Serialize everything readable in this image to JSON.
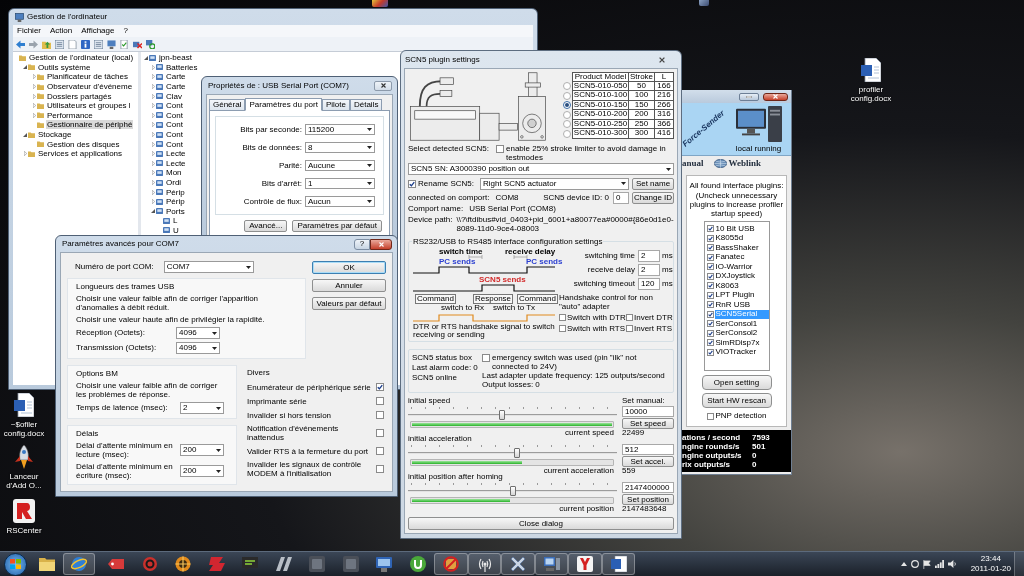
{
  "desktop_icons": [
    {
      "kind": "document",
      "label": "profiler config.docx"
    },
    {
      "kind": "document",
      "label": "~$ofiler config.docx"
    },
    {
      "kind": "rocket",
      "label": "Lanceur d'Add O..."
    },
    {
      "kind": "app",
      "label": "RSCenter"
    }
  ],
  "computer_management": {
    "title": "Gestion de l'ordinateur",
    "menu": [
      "Fichier",
      "Action",
      "Affichage",
      "?"
    ],
    "nav_tree": [
      {
        "label": "Gestion de l'ordinateur (local)",
        "selected": false,
        "children": [
          {
            "label": "Outils système",
            "expanded": true,
            "selected": false,
            "children": [
              {
                "label": "Planificateur de tâches",
                "expanded": false,
                "selected": false
              },
              {
                "label": "Observateur d'événeme",
                "expanded": false,
                "selected": false
              },
              {
                "label": "Dossiers partagés",
                "expanded": false,
                "selected": false
              },
              {
                "label": "Utilisateurs et groupes l",
                "expanded": false,
                "selected": false
              },
              {
                "label": "Performance",
                "expanded": false,
                "selected": false
              },
              {
                "label": "Gestionnaire de périphé",
                "selected": true
              }
            ]
          },
          {
            "label": "Stockage",
            "expanded": true,
            "selected": false,
            "children": [
              {
                "label": "Gestion des disques",
                "selected": false
              }
            ]
          },
          {
            "label": "Services et applications",
            "expanded": false,
            "selected": false
          }
        ]
      }
    ],
    "device_tree": [
      {
        "label": "jpn-beast",
        "expanded": true,
        "children": [
          {
            "label": "Batteries",
            "expanded": false
          },
          {
            "label": "Carte",
            "expanded": false
          },
          {
            "label": "Carte",
            "expanded": false
          },
          {
            "label": "Clav",
            "expanded": false
          },
          {
            "label": "Cont",
            "expanded": false
          },
          {
            "label": "Cont",
            "expanded": false
          },
          {
            "label": "Cont",
            "expanded": false
          },
          {
            "label": "Cont",
            "expanded": false
          },
          {
            "label": "Cont",
            "expanded": false
          },
          {
            "label": "Lecte",
            "expanded": false
          },
          {
            "label": "Lecte",
            "expanded": false
          },
          {
            "label": "Mon",
            "expanded": false
          },
          {
            "label": "Ordi",
            "expanded": false
          },
          {
            "label": "Périp",
            "expanded": false
          },
          {
            "label": "Périp",
            "expanded": false
          },
          {
            "label": "Ports",
            "expanded": true,
            "children": [
              {
                "label": "L"
              },
              {
                "label": "U"
              }
            ]
          }
        ]
      }
    ]
  },
  "properties": {
    "title": "Propriétés de : USB Serial Port (COM7)",
    "tabs": [
      {
        "label": "Général",
        "selected": false
      },
      {
        "label": "Paramètres du port",
        "selected": true
      },
      {
        "label": "Pilote",
        "selected": false
      },
      {
        "label": "Détails",
        "selected": false
      }
    ],
    "fields": [
      {
        "label": "Bits par seconde:",
        "value": "115200"
      },
      {
        "label": "Bits de données:",
        "value": "8"
      },
      {
        "label": "Parité:",
        "value": "Aucune"
      },
      {
        "label": "Bits d'arrêt:",
        "value": "1"
      },
      {
        "label": "Contrôle de flux:",
        "value": "Aucun"
      }
    ],
    "buttons": [
      "Avancé...",
      "Paramètres par défaut"
    ]
  },
  "advanced": {
    "title": "Paramètres avancés pour COM7",
    "help": "?",
    "port": {
      "label": "Numéro de port COM:",
      "value": "COM7"
    },
    "usb": {
      "title": "Longueurs des trames USB",
      "lines": [
        "Choisir une valeur faible afin de corriger l'apparition d'anomalies à débit réduit.",
        "Choisir une valeur haute afin de privilégier la rapidité."
      ],
      "fields": [
        {
          "label": "Réception (Octets):",
          "value": "4096"
        },
        {
          "label": "Transmission (Octets):",
          "value": "4096"
        }
      ]
    },
    "bm": {
      "title": "Options BM",
      "text": "Choisir une valeur faible afin de corriger les problèmes de réponse.",
      "field": {
        "label": "Temps de latence (msec):",
        "value": "2"
      }
    },
    "delays": {
      "title": "Délais",
      "fields": [
        {
          "label": "Délai d'attente minimum en lecture (msec):",
          "value": "200"
        },
        {
          "label": "Délai d'attente minimum en écriture (msec):",
          "value": "200"
        }
      ]
    },
    "misc": {
      "title": "Divers",
      "options": [
        {
          "label": "Enumérateur de périphérique série",
          "checked": true
        },
        {
          "label": "Imprimante série",
          "checked": false
        },
        {
          "label": "Invalider si hors tension",
          "checked": false
        },
        {
          "label": "Notification d'événements inattendus",
          "checked": false
        },
        {
          "label": "Valider RTS à la fermeture du port",
          "checked": false
        },
        {
          "label": "Invalider les signaux de contrôle MODEM à l'initialisation",
          "checked": false
        }
      ]
    },
    "buttons": [
      {
        "label": "OK",
        "default": true
      },
      {
        "label": "Annuler",
        "default": false
      },
      {
        "label": "Valeurs par défaut",
        "default": false
      }
    ]
  },
  "scn5": {
    "title": "SCN5 plugin settings",
    "models": {
      "columns": [
        "Product Model",
        "Stroke",
        "L"
      ],
      "rows": [
        {
          "cells": [
            "SCN5-010-050",
            "50",
            "166"
          ],
          "selected": false
        },
        {
          "cells": [
            "SCN5-010-100",
            "100",
            "216"
          ],
          "selected": false
        },
        {
          "cells": [
            "SCN5-010-150",
            "150",
            "266"
          ],
          "selected": true
        },
        {
          "cells": [
            "SCN5-010-200",
            "200",
            "316"
          ],
          "selected": false
        },
        {
          "cells": [
            "SCN5-010-250",
            "250",
            "366"
          ],
          "selected": false
        },
        {
          "cells": [
            "SCN5-010-300",
            "300",
            "416"
          ],
          "selected": false
        }
      ]
    },
    "select_label": "Select detected SCN5:",
    "stroke_limiter": {
      "label": "enable 25% stroke limiter to avoid damage in testmodes",
      "checked": false
    },
    "detected": "SCN5 SN: A3000390 position out",
    "rename": {
      "label": "Rename SCN5:",
      "checked": true,
      "value": "Right SCN5 actuator",
      "button": "Set name"
    },
    "connection": {
      "label": "connected on comport:",
      "comport": "COM8",
      "device_id_label": "SCN5 device ID: 0",
      "device_id": "0",
      "button": "Change ID"
    },
    "comport_name": {
      "label": "Comport name:",
      "value": "USB Serial Port (COM8)"
    },
    "device_path": {
      "label": "Device path:",
      "value": "\\\\?\\ftdibus#vid_0403+pid_6001+a80077ea#0000#{86e0d1e0-8089-11d0-9ce4-08003"
    },
    "interface": {
      "title": "RS232/USB to RS485 interface configuration settings",
      "diagram": {
        "switch_time": "switch time",
        "receive_delay": "receive delay",
        "senders": [
          {
            "label": "PC sends",
            "color": "#2b3fd0"
          },
          {
            "label": "SCN5 sends",
            "color": "#d22b2b"
          },
          {
            "label": "PC sends",
            "color": "#2b3fd0"
          }
        ],
        "frames": [
          {
            "kind": "box",
            "label": "Command"
          },
          {
            "kind": "note",
            "label": "switch to Rx"
          },
          {
            "kind": "box",
            "label": "Response"
          },
          {
            "kind": "note",
            "label": "switch to Tx"
          },
          {
            "kind": "box",
            "label": "Command"
          }
        ],
        "caption": "DTR or RTS handshake signal to switch receiving or sending"
      },
      "timings": [
        {
          "label": "switching time",
          "value": "2",
          "unit": "ms"
        },
        {
          "label": "receive delay",
          "value": "2",
          "unit": "ms"
        },
        {
          "label": "switching timeout",
          "value": "120",
          "unit": "ms"
        }
      ],
      "handshake_title": "Handshake control for non \"auto\" adapter",
      "handshake": [
        {
          "label": "Switch with DTR",
          "checked": false
        },
        {
          "label": "Invert DTR",
          "checked": false
        },
        {
          "label": "Switch with RTS",
          "checked": false
        },
        {
          "label": "Invert RTS",
          "checked": false
        }
      ]
    },
    "status": {
      "title": "SCN5 status box",
      "alarm": "Last alarm code: 0",
      "online": "SCN5 online",
      "emergency": {
        "label": "emergency switch was used (pin \"ilk\" not connected to 24V)",
        "checked": false
      },
      "frequency": "Last adapter update frequency: 125 outputs/second",
      "losses": "Output losses: 0"
    },
    "set_manual": "Set manual:",
    "controls": [
      {
        "label": "initial speed",
        "slider": {
          "level": 0.45
        },
        "progress": {
          "level": 1
        },
        "current_label": "current speed",
        "input": "10000",
        "button": "Set speed",
        "current": "22499"
      },
      {
        "label": "initial acceleration",
        "slider": {
          "level": 0.52
        },
        "progress": {
          "level": 0.55
        },
        "current_label": "current acceleration",
        "input": "512",
        "button": "Set accel.",
        "current": "559"
      },
      {
        "label": "initial position after homing",
        "slider": {
          "level": 0.5
        },
        "progress": {
          "level": 0.49
        },
        "current_label": "current position",
        "input": "2147400000",
        "button": "Set position",
        "current": "2147483648"
      }
    ],
    "close": "Close dialog"
  },
  "force_sender": {
    "banner_title": "Force-Sender",
    "banner_status": "local running",
    "links": [
      {
        "label": "anual",
        "icon": false
      },
      {
        "label": "Weblink",
        "icon": true
      }
    ],
    "plugins_heading": "All found interface plugins:",
    "plugins_hint": "(Uncheck unnecessary plugins to increase profiler startup speed)",
    "plugins": [
      {
        "label": "10 Bit USB",
        "checked": true,
        "selected": false
      },
      {
        "label": "K8055d",
        "checked": true,
        "selected": false
      },
      {
        "label": "BassShaker",
        "checked": true,
        "selected": false
      },
      {
        "label": "Fanatec",
        "checked": true,
        "selected": false
      },
      {
        "label": "IO-Warrior",
        "checked": true,
        "selected": false
      },
      {
        "label": "DXJoystick",
        "checked": true,
        "selected": false
      },
      {
        "label": "K8063",
        "checked": true,
        "selected": false
      },
      {
        "label": "LPT Plugin",
        "checked": true,
        "selected": false
      },
      {
        "label": "RnR USB",
        "checked": true,
        "selected": false
      },
      {
        "label": "SCN5Serial",
        "checked": true,
        "selected": true
      },
      {
        "label": "SerConsol1",
        "checked": true,
        "selected": false
      },
      {
        "label": "SerConsol2",
        "checked": true,
        "selected": false
      },
      {
        "label": "SimRDisp7x",
        "checked": true,
        "selected": false
      },
      {
        "label": "VIOTracker",
        "checked": true,
        "selected": false
      }
    ],
    "buttons": [
      "Open setting",
      "Start HW rescan"
    ],
    "pnp": {
      "label": "PNP detection",
      "checked": false
    },
    "stats": [
      {
        "label": "ations / second",
        "value": "7593"
      },
      {
        "label": "ngine rounds/s",
        "value": "501"
      },
      {
        "label": "ngine outputs/s",
        "value": "0"
      },
      {
        "label": "rix outputs/s",
        "value": "0"
      }
    ]
  },
  "taskbar": {
    "apps": [
      {
        "kind": "folder",
        "running": false
      },
      {
        "kind": "browser",
        "running": true
      },
      {
        "kind": "tag",
        "running": false
      },
      {
        "kind": "ring",
        "running": false
      },
      {
        "kind": "wheel",
        "running": false
      },
      {
        "kind": "swoosh",
        "running": false
      },
      {
        "kind": "bubble",
        "running": false
      },
      {
        "kind": "slash",
        "running": false
      },
      {
        "kind": "tile",
        "running": false
      },
      {
        "kind": "tile",
        "running": false
      },
      {
        "kind": "monitor",
        "running": false
      },
      {
        "kind": "circle",
        "running": false
      },
      {
        "kind": "prohibited",
        "running": true
      },
      {
        "kind": "antenna",
        "running": true
      },
      {
        "kind": "cross",
        "running": true
      },
      {
        "kind": "computer",
        "running": true
      },
      {
        "kind": "fork",
        "running": true
      },
      {
        "kind": "document",
        "running": true
      }
    ],
    "time": "23:44",
    "date": "2011-01-20"
  }
}
